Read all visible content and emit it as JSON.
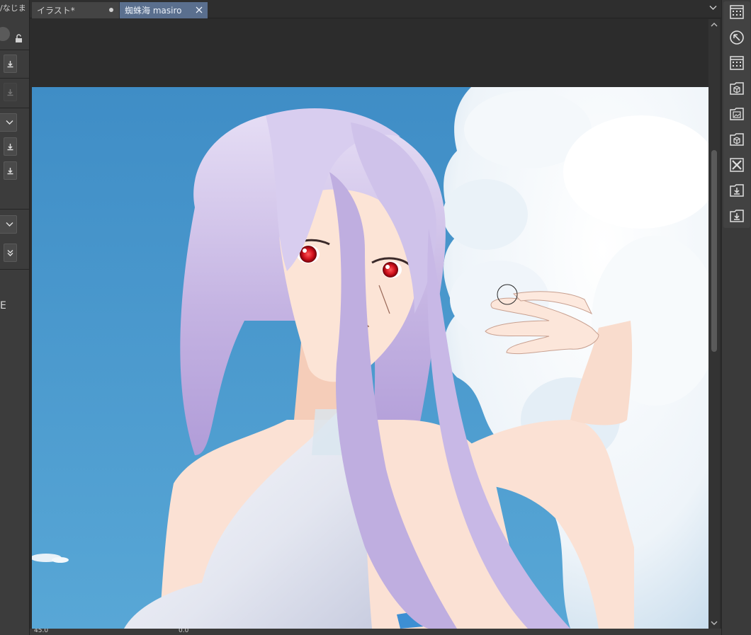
{
  "app": {
    "left_panel": {
      "top_text": "/なじま",
      "letter": "E"
    },
    "tabs": [
      {
        "label": "イラスト*",
        "modified": true,
        "active": false
      },
      {
        "label": "蜘蛛海 masiro",
        "modified": false,
        "active": true
      }
    ],
    "status": {
      "zoom": "45.0",
      "rotation": "0.0"
    },
    "right_toolbar": {
      "buttons": [
        {
          "icon": "grid-panel-icon"
        },
        {
          "icon": "navigator-icon"
        },
        {
          "icon": "grid-panel-icon"
        },
        {
          "icon": "3d-cube-icon"
        },
        {
          "icon": "image-folder-icon"
        },
        {
          "icon": "3d-cube-icon"
        },
        {
          "icon": "close-panel-icon"
        },
        {
          "icon": "download-folder-icon"
        },
        {
          "icon": "download-folder-icon"
        }
      ]
    },
    "colors": {
      "sky": "#4b95c9",
      "hair": "#c6b6e3",
      "skin": "#fbe1d4",
      "eye": "#d0101c",
      "active_tab": "#5a6f8e"
    }
  }
}
